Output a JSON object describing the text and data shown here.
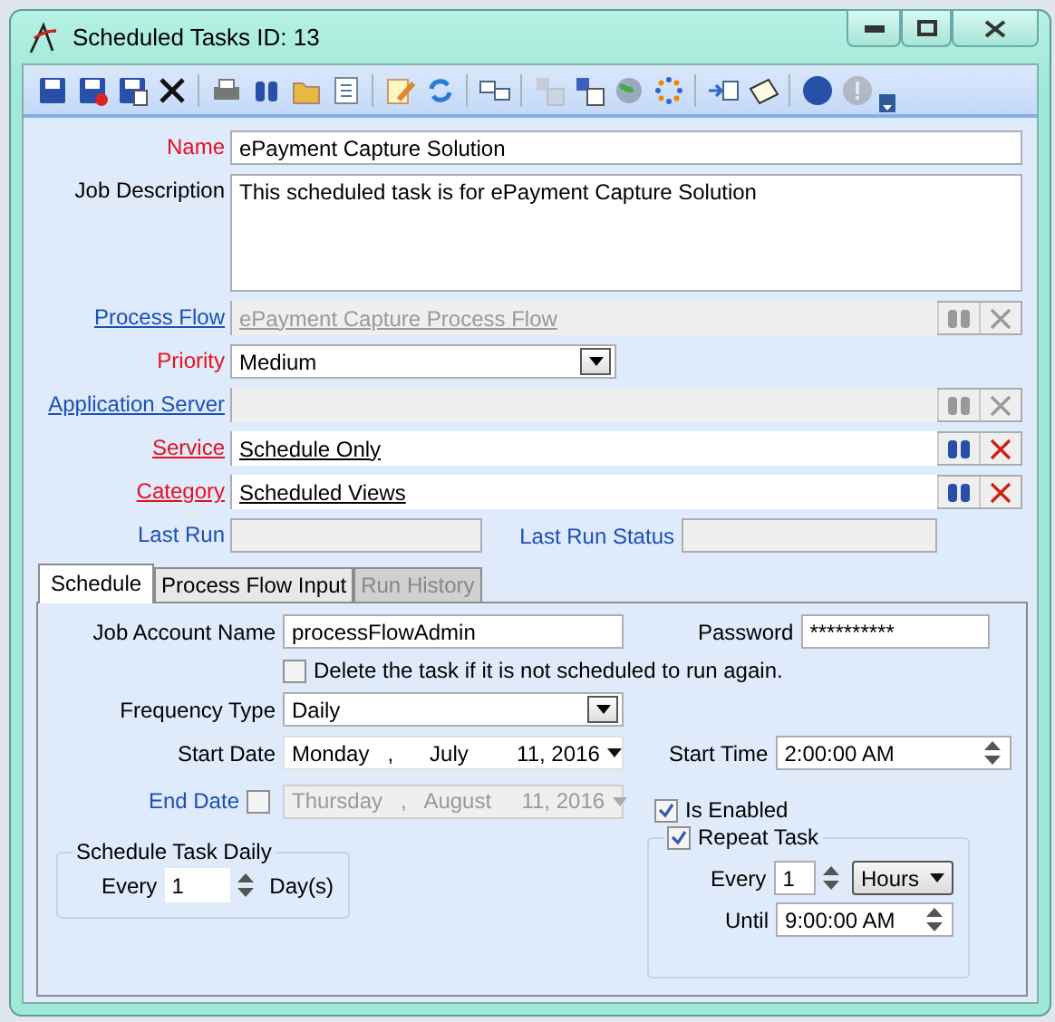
{
  "window": {
    "title": "Scheduled Tasks ID: 13"
  },
  "toolbar": {
    "buttons": [
      {
        "disabled": false
      },
      {
        "disabled": false
      },
      {
        "disabled": false
      },
      {
        "disabled": false
      },
      {
        "disabled": false
      },
      {
        "disabled": false
      },
      {
        "disabled": false
      },
      {
        "disabled": false
      },
      {
        "disabled": false
      },
      {
        "disabled": false
      },
      {
        "disabled": false
      },
      {
        "disabled": true
      },
      {
        "disabled": false
      },
      {
        "disabled": false
      },
      {
        "disabled": false
      },
      {
        "disabled": false
      },
      {
        "disabled": false
      },
      {
        "disabled": false
      },
      {
        "disabled": true
      }
    ]
  },
  "fields": [
    {
      "kind": "text",
      "label": "Name",
      "required": true,
      "link": false,
      "value": "ePayment Capture Solution"
    },
    {
      "kind": "textarea",
      "label": "Job Description",
      "required": false,
      "link": false,
      "value": "This scheduled task is for ePayment Capture Solution"
    },
    {
      "kind": "lookup",
      "label": "Process Flow",
      "required": false,
      "link": true,
      "disabled": true,
      "value": "ePayment Capture Process Flow"
    },
    {
      "kind": "select",
      "label": "Priority",
      "required": true,
      "link": false,
      "value": "Medium"
    },
    {
      "kind": "lookup",
      "label": "Application Server",
      "required": false,
      "link": true,
      "disabled": true
    },
    {
      "kind": "lookup",
      "label": "Service",
      "required": true,
      "link": true,
      "disabled": false,
      "value": "Schedule Only"
    },
    {
      "kind": "lookup",
      "label": "Category",
      "required": true,
      "link": true,
      "disabled": false,
      "value": "Scheduled Views"
    },
    {
      "kind": "pair",
      "items": [
        {
          "label": "Last Run"
        },
        {
          "label": "Last Run Status"
        }
      ]
    }
  ],
  "tabs": [
    {
      "label": "Schedule",
      "selected": true,
      "disabled": false
    },
    {
      "label": "Process Flow Input",
      "selected": false,
      "disabled": false
    },
    {
      "label": "Run History",
      "selected": false,
      "disabled": true
    }
  ],
  "schedule": {
    "job_account_name": {
      "label": "Job Account Name",
      "value": "processFlowAdmin"
    },
    "password": {
      "label": "Password",
      "value": "**********"
    },
    "delete_if_not_scheduled": {
      "label": "Delete the task if it is not scheduled to run again.",
      "checked": false
    },
    "frequency_type": {
      "label": "Frequency Type",
      "value": "Daily"
    },
    "start_date": {
      "label": "Start Date",
      "value": "Monday   ,      July        11, 2016"
    },
    "start_time": {
      "label": "Start Time",
      "value": "2:00:00 AM"
    },
    "end_date": {
      "label": "End Date",
      "checked": false,
      "value": "Thursday   ,   August     11, 2016"
    },
    "is_enabled": {
      "label": "Is Enabled",
      "checked": true
    },
    "daily": {
      "title": "Schedule Task Daily",
      "every_label": "Every",
      "every": "1",
      "unit": "Day(s)"
    },
    "repeat": {
      "label": "Repeat Task",
      "checked": true,
      "every_label": "Every",
      "every": "1",
      "unit": "Hours",
      "until_label": "Until",
      "until": "9:00:00 AM"
    }
  }
}
